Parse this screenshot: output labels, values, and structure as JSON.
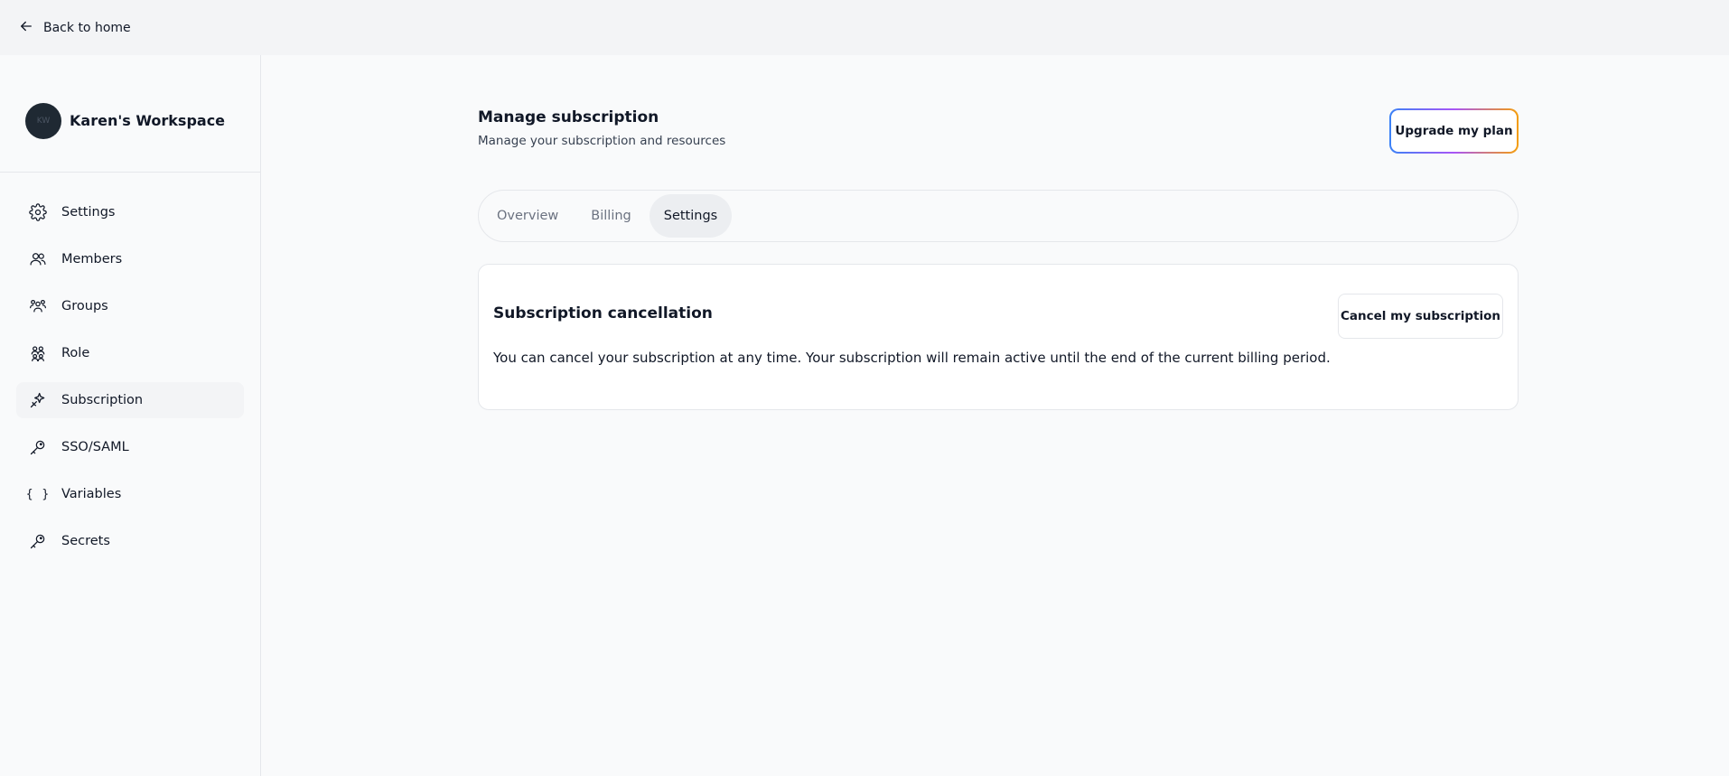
{
  "topbar": {
    "back_label": "Back to home"
  },
  "workspace": {
    "name": "Karen's Workspace",
    "avatar_text": "KW"
  },
  "sidebar": {
    "items": [
      {
        "label": "Settings",
        "icon": "gear-icon"
      },
      {
        "label": "Members",
        "icon": "users-icon"
      },
      {
        "label": "Groups",
        "icon": "group-icon"
      },
      {
        "label": "Role",
        "icon": "role-icon"
      },
      {
        "label": "Subscription",
        "icon": "sparkles-icon",
        "active": true
      },
      {
        "label": "SSO/SAML",
        "icon": "key-icon"
      },
      {
        "label": "Variables",
        "icon": "braces-icon"
      },
      {
        "label": "Secrets",
        "icon": "key-icon"
      }
    ]
  },
  "main": {
    "title": "Manage subscription",
    "subtitle": "Manage your subscription and resources",
    "upgrade_label": "Upgrade my plan",
    "tabs": [
      {
        "label": "Overview"
      },
      {
        "label": "Billing"
      },
      {
        "label": "Settings",
        "active": true
      }
    ],
    "card": {
      "title": "Subscription cancellation",
      "description": "You can cancel your subscription at any time. Your subscription will remain active until the end of the current billing period.",
      "cancel_label": "Cancel my subscription"
    }
  },
  "colors": {
    "background": "#f9fafb",
    "topbar": "#f3f4f6",
    "upgrade_gradient": [
      "#3b82f6",
      "#a855f7",
      "#f59e0b"
    ]
  }
}
